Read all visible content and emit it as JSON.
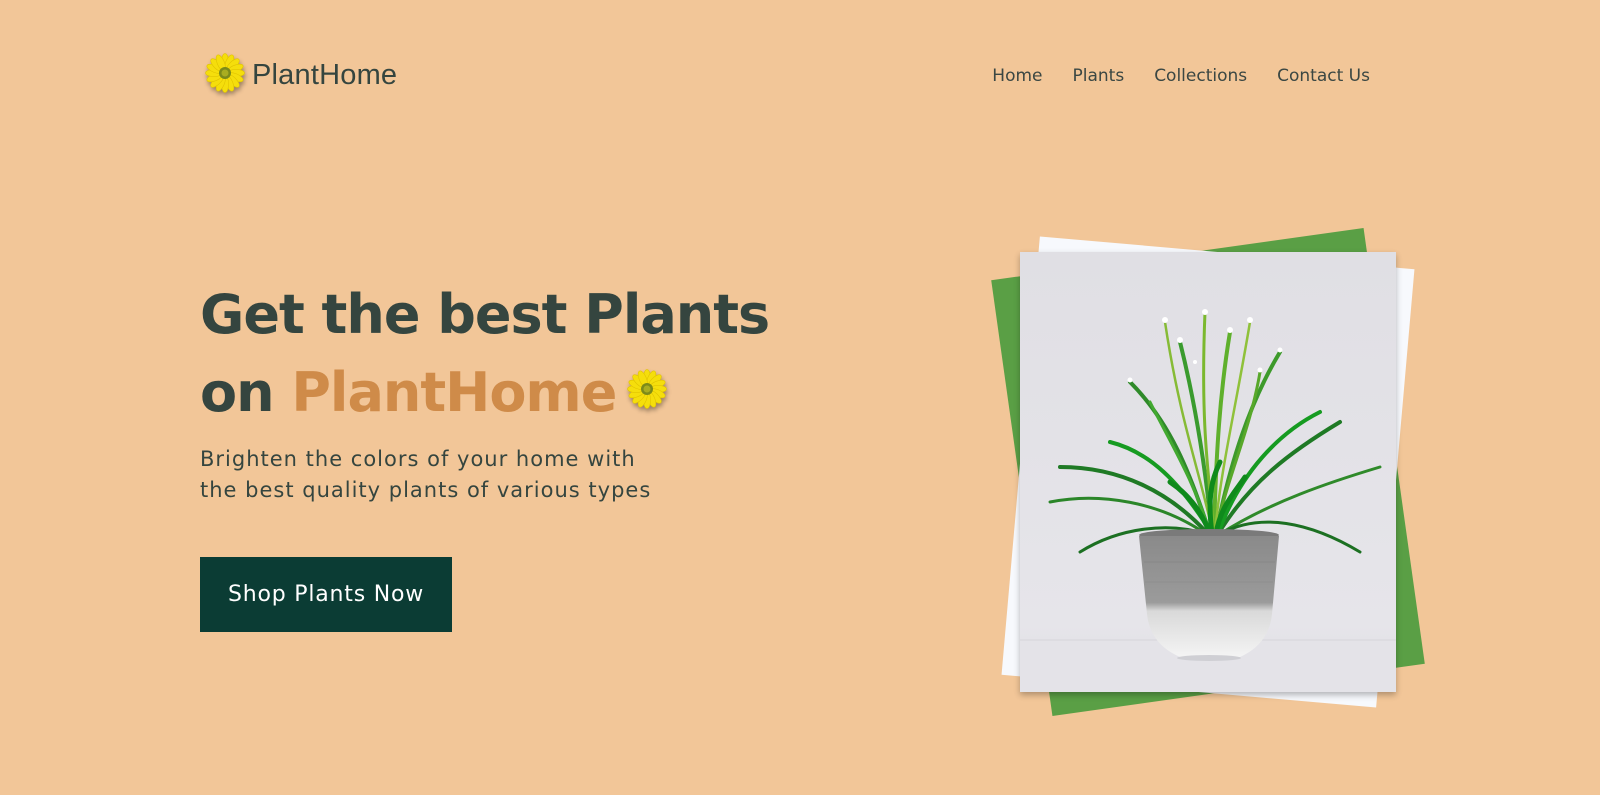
{
  "header": {
    "logo_icon": "daisy-flower-icon",
    "brand": "PlantHome",
    "nav": [
      "Home",
      "Plants",
      "Collections",
      "Contact Us"
    ]
  },
  "hero": {
    "title_line1": "Get the best Plants",
    "title_prefix": "on",
    "title_brand": "PlantHome",
    "title_icon": "daisy-flower-icon",
    "subtitle_line1": "Brighten the colors of your home with",
    "subtitle_line2": "the best quality plants of various types",
    "cta_label": "Shop Plants Now"
  },
  "image": {
    "subject": "potted-grass-plant-photo"
  },
  "colors": {
    "background": "#f2c698",
    "text": "#35453f",
    "accent": "#cf8b49",
    "cta": "#0b3c34",
    "back_card_green": "#5a9f45",
    "back_card_white": "#f7f9fd"
  }
}
